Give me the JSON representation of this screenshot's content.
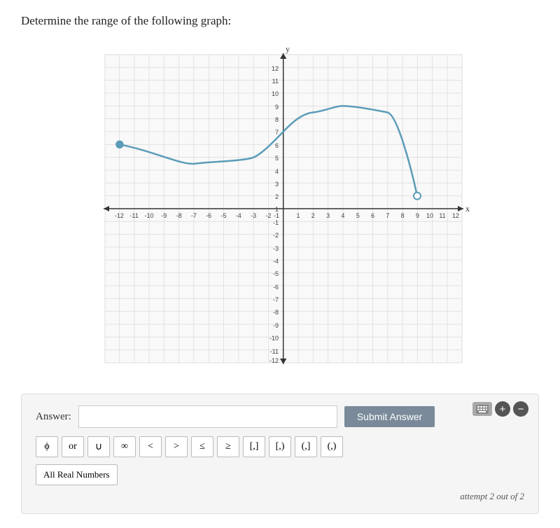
{
  "question": "Determine the range of the following graph:",
  "answer": {
    "label": "Answer:",
    "input_placeholder": "",
    "submit_label": "Submit Answer"
  },
  "symbols": [
    {
      "label": "ϕ",
      "name": "phi"
    },
    {
      "label": "or",
      "name": "or"
    },
    {
      "label": "∪",
      "name": "union"
    },
    {
      "label": "∞",
      "name": "infinity"
    },
    {
      "label": "<",
      "name": "less-than"
    },
    {
      "label": ">",
      "name": "greater-than"
    },
    {
      "label": "≤",
      "name": "less-equal"
    },
    {
      "label": "≥",
      "name": "greater-equal"
    },
    {
      "label": "[,]",
      "name": "closed-interval"
    },
    {
      "label": "[,)",
      "name": "left-closed-interval"
    },
    {
      "label": "(,]",
      "name": "right-closed-interval"
    },
    {
      "label": "(,)",
      "name": "open-interval"
    }
  ],
  "all_real_label": "All Real Numbers",
  "attempt_text": "attempt 2 out of 2",
  "graph": {
    "x_min": -12,
    "x_max": 12,
    "y_min": -12,
    "y_max": 12,
    "curve_points": [
      [
        -11,
        5
      ],
      [
        -6,
        3.5
      ],
      [
        -2,
        4
      ],
      [
        0,
        6
      ],
      [
        2,
        7.5
      ],
      [
        4,
        8
      ],
      [
        7,
        7.5
      ],
      [
        9,
        1
      ]
    ],
    "start_filled": true,
    "end_filled": false
  }
}
